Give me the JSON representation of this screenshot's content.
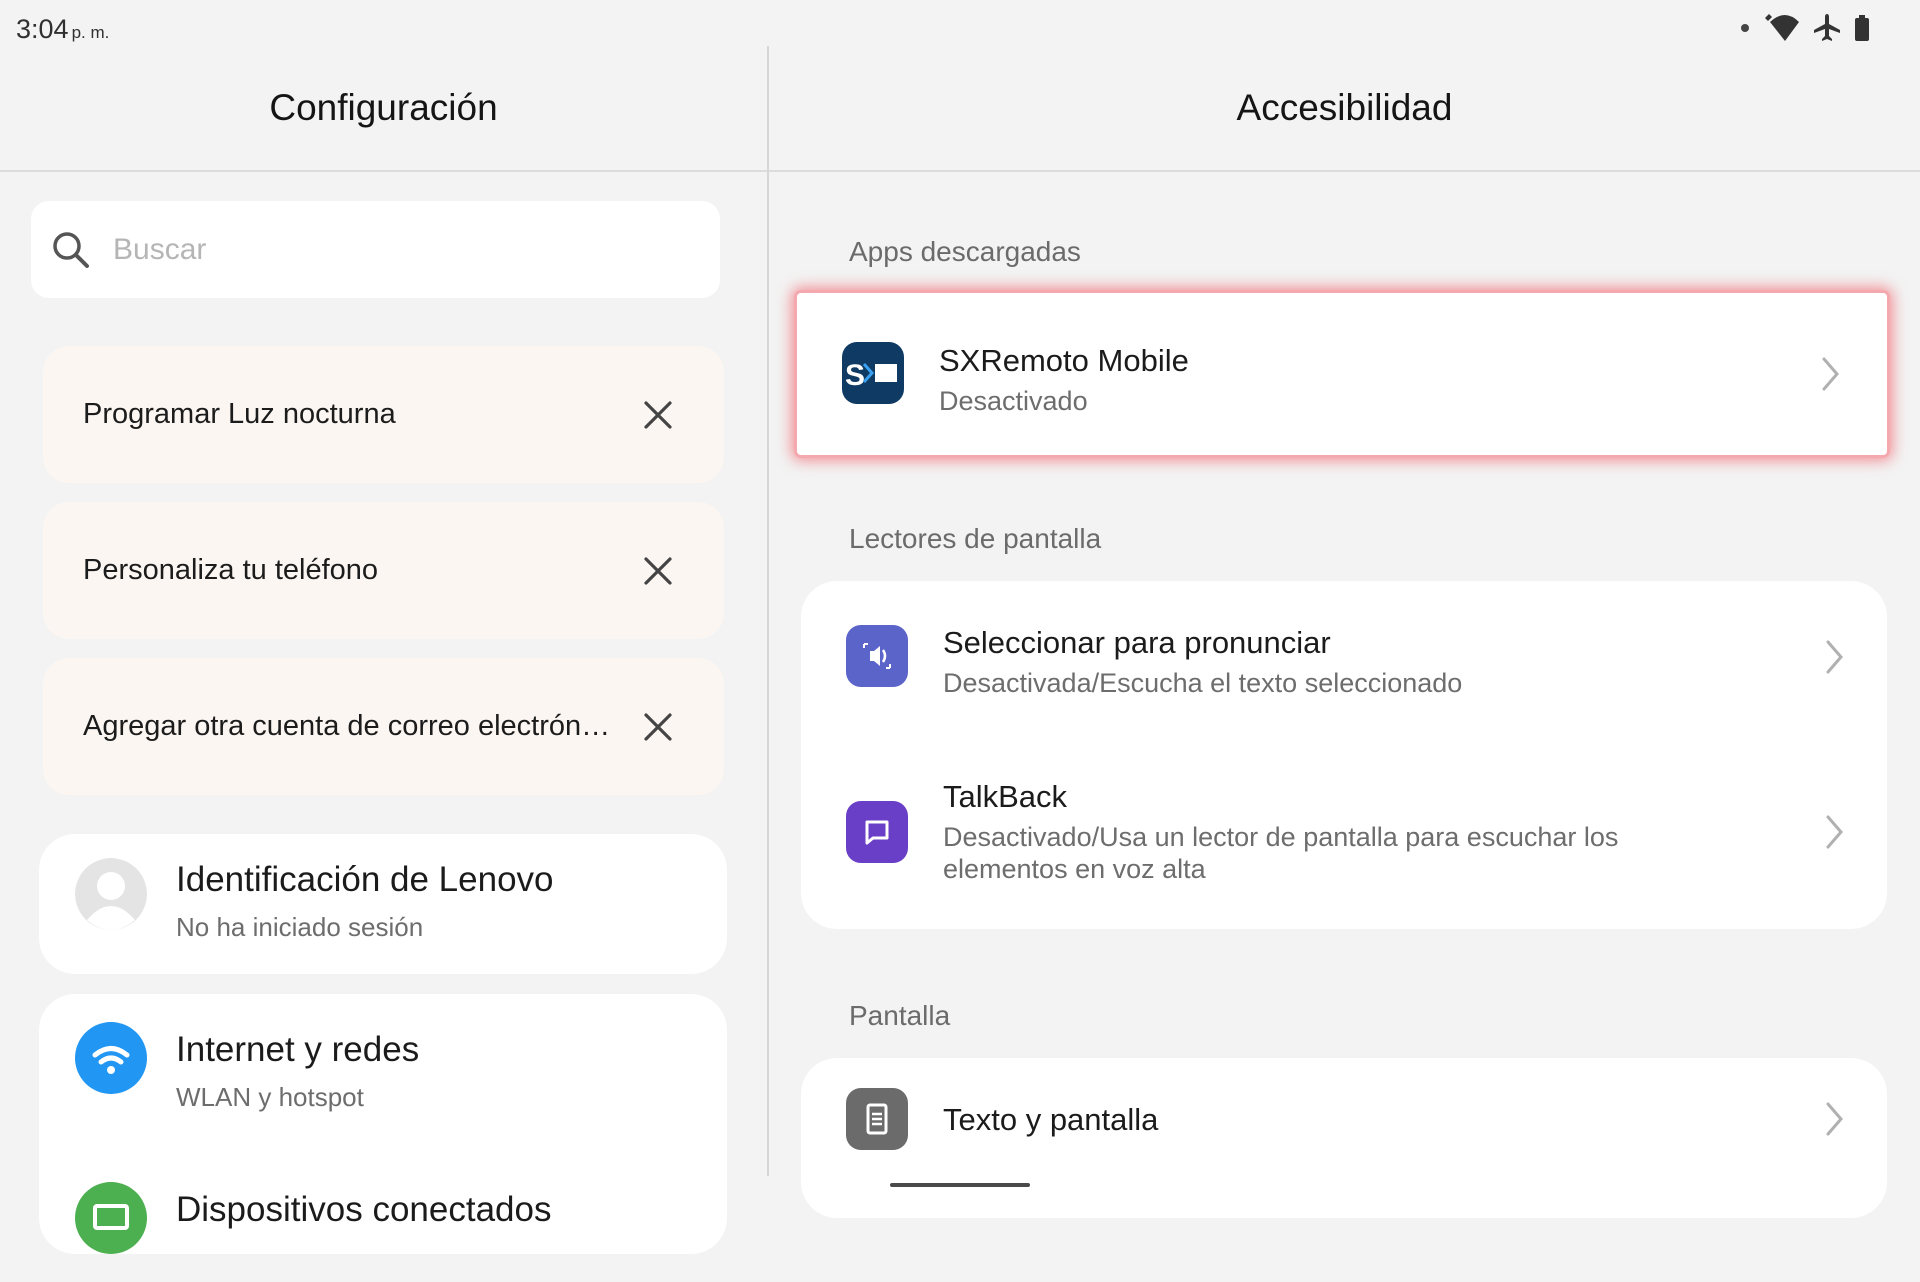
{
  "status_bar": {
    "time": "3:04",
    "ampm": "p. m.",
    "icons": [
      "dot-icon",
      "wifi-icon",
      "airplane-icon",
      "battery-icon"
    ]
  },
  "left_pane": {
    "title": "Configuración",
    "search": {
      "placeholder": "Buscar",
      "value": ""
    },
    "suggestions": [
      {
        "label": "Programar Luz nocturna"
      },
      {
        "label": "Personaliza tu teléfono"
      },
      {
        "label": "Agregar otra cuenta de correo electrónico"
      }
    ],
    "account": {
      "title": "Identificación de Lenovo",
      "subtitle": "No ha iniciado sesión"
    },
    "items": [
      {
        "title": "Internet y redes",
        "subtitle": "WLAN y hotspot",
        "icon": "wifi-icon",
        "color": "#2196f3"
      },
      {
        "title": "Dispositivos conectados",
        "subtitle": "",
        "icon": "devices-icon",
        "color": "#4caf50"
      }
    ]
  },
  "right_pane": {
    "title": "Accesibilidad",
    "sections": [
      {
        "header": "Apps descargadas",
        "items": [
          {
            "title": "SXRemoto Mobile",
            "subtitle": "Desactivado",
            "icon": "sxremoto-app-icon"
          }
        ]
      },
      {
        "header": "Lectores de pantalla",
        "items": [
          {
            "title": "Seleccionar para pronunciar",
            "subtitle": "Desactivada/Escucha el texto seleccionado",
            "icon": "speaker-icon",
            "color": "#5b64c9"
          },
          {
            "title": "TalkBack",
            "subtitle": "Desactivado/Usa un lector de pantalla para escuchar los elementos en voz alta",
            "icon": "chat-bubble-icon",
            "color": "#6a3fc7"
          }
        ]
      },
      {
        "header": "Pantalla",
        "items": [
          {
            "title": "Texto y pantalla",
            "subtitle": "",
            "icon": "display-text-icon",
            "color": "#6b6b6b"
          }
        ]
      }
    ]
  },
  "colors": {
    "highlight": "#f04650",
    "accent_blue": "#2196f3"
  }
}
